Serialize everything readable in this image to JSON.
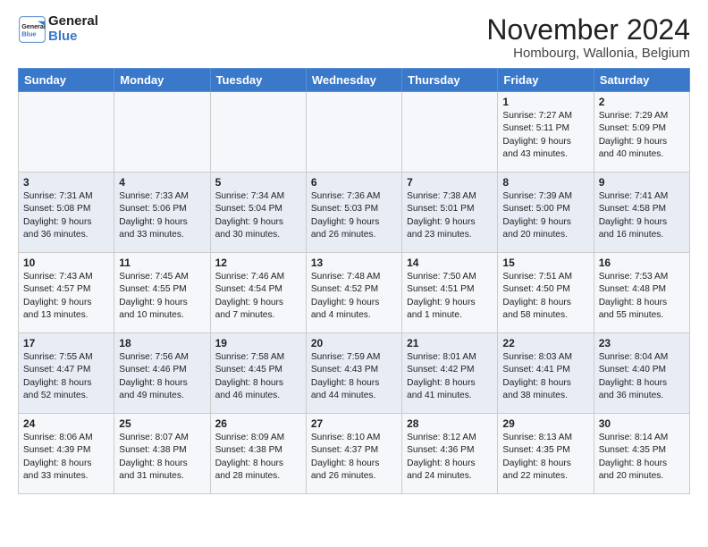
{
  "header": {
    "title": "November 2024",
    "subtitle": "Hombourg, Wallonia, Belgium"
  },
  "logo": {
    "line1": "General",
    "line2": "Blue"
  },
  "days_of_week": [
    "Sunday",
    "Monday",
    "Tuesday",
    "Wednesday",
    "Thursday",
    "Friday",
    "Saturday"
  ],
  "weeks": [
    [
      {
        "day": "",
        "info": ""
      },
      {
        "day": "",
        "info": ""
      },
      {
        "day": "",
        "info": ""
      },
      {
        "day": "",
        "info": ""
      },
      {
        "day": "",
        "info": ""
      },
      {
        "day": "1",
        "info": "Sunrise: 7:27 AM\nSunset: 5:11 PM\nDaylight: 9 hours\nand 43 minutes."
      },
      {
        "day": "2",
        "info": "Sunrise: 7:29 AM\nSunset: 5:09 PM\nDaylight: 9 hours\nand 40 minutes."
      }
    ],
    [
      {
        "day": "3",
        "info": "Sunrise: 7:31 AM\nSunset: 5:08 PM\nDaylight: 9 hours\nand 36 minutes."
      },
      {
        "day": "4",
        "info": "Sunrise: 7:33 AM\nSunset: 5:06 PM\nDaylight: 9 hours\nand 33 minutes."
      },
      {
        "day": "5",
        "info": "Sunrise: 7:34 AM\nSunset: 5:04 PM\nDaylight: 9 hours\nand 30 minutes."
      },
      {
        "day": "6",
        "info": "Sunrise: 7:36 AM\nSunset: 5:03 PM\nDaylight: 9 hours\nand 26 minutes."
      },
      {
        "day": "7",
        "info": "Sunrise: 7:38 AM\nSunset: 5:01 PM\nDaylight: 9 hours\nand 23 minutes."
      },
      {
        "day": "8",
        "info": "Sunrise: 7:39 AM\nSunset: 5:00 PM\nDaylight: 9 hours\nand 20 minutes."
      },
      {
        "day": "9",
        "info": "Sunrise: 7:41 AM\nSunset: 4:58 PM\nDaylight: 9 hours\nand 16 minutes."
      }
    ],
    [
      {
        "day": "10",
        "info": "Sunrise: 7:43 AM\nSunset: 4:57 PM\nDaylight: 9 hours\nand 13 minutes."
      },
      {
        "day": "11",
        "info": "Sunrise: 7:45 AM\nSunset: 4:55 PM\nDaylight: 9 hours\nand 10 minutes."
      },
      {
        "day": "12",
        "info": "Sunrise: 7:46 AM\nSunset: 4:54 PM\nDaylight: 9 hours\nand 7 minutes."
      },
      {
        "day": "13",
        "info": "Sunrise: 7:48 AM\nSunset: 4:52 PM\nDaylight: 9 hours\nand 4 minutes."
      },
      {
        "day": "14",
        "info": "Sunrise: 7:50 AM\nSunset: 4:51 PM\nDaylight: 9 hours\nand 1 minute."
      },
      {
        "day": "15",
        "info": "Sunrise: 7:51 AM\nSunset: 4:50 PM\nDaylight: 8 hours\nand 58 minutes."
      },
      {
        "day": "16",
        "info": "Sunrise: 7:53 AM\nSunset: 4:48 PM\nDaylight: 8 hours\nand 55 minutes."
      }
    ],
    [
      {
        "day": "17",
        "info": "Sunrise: 7:55 AM\nSunset: 4:47 PM\nDaylight: 8 hours\nand 52 minutes."
      },
      {
        "day": "18",
        "info": "Sunrise: 7:56 AM\nSunset: 4:46 PM\nDaylight: 8 hours\nand 49 minutes."
      },
      {
        "day": "19",
        "info": "Sunrise: 7:58 AM\nSunset: 4:45 PM\nDaylight: 8 hours\nand 46 minutes."
      },
      {
        "day": "20",
        "info": "Sunrise: 7:59 AM\nSunset: 4:43 PM\nDaylight: 8 hours\nand 44 minutes."
      },
      {
        "day": "21",
        "info": "Sunrise: 8:01 AM\nSunset: 4:42 PM\nDaylight: 8 hours\nand 41 minutes."
      },
      {
        "day": "22",
        "info": "Sunrise: 8:03 AM\nSunset: 4:41 PM\nDaylight: 8 hours\nand 38 minutes."
      },
      {
        "day": "23",
        "info": "Sunrise: 8:04 AM\nSunset: 4:40 PM\nDaylight: 8 hours\nand 36 minutes."
      }
    ],
    [
      {
        "day": "24",
        "info": "Sunrise: 8:06 AM\nSunset: 4:39 PM\nDaylight: 8 hours\nand 33 minutes."
      },
      {
        "day": "25",
        "info": "Sunrise: 8:07 AM\nSunset: 4:38 PM\nDaylight: 8 hours\nand 31 minutes."
      },
      {
        "day": "26",
        "info": "Sunrise: 8:09 AM\nSunset: 4:38 PM\nDaylight: 8 hours\nand 28 minutes."
      },
      {
        "day": "27",
        "info": "Sunrise: 8:10 AM\nSunset: 4:37 PM\nDaylight: 8 hours\nand 26 minutes."
      },
      {
        "day": "28",
        "info": "Sunrise: 8:12 AM\nSunset: 4:36 PM\nDaylight: 8 hours\nand 24 minutes."
      },
      {
        "day": "29",
        "info": "Sunrise: 8:13 AM\nSunset: 4:35 PM\nDaylight: 8 hours\nand 22 minutes."
      },
      {
        "day": "30",
        "info": "Sunrise: 8:14 AM\nSunset: 4:35 PM\nDaylight: 8 hours\nand 20 minutes."
      }
    ]
  ]
}
